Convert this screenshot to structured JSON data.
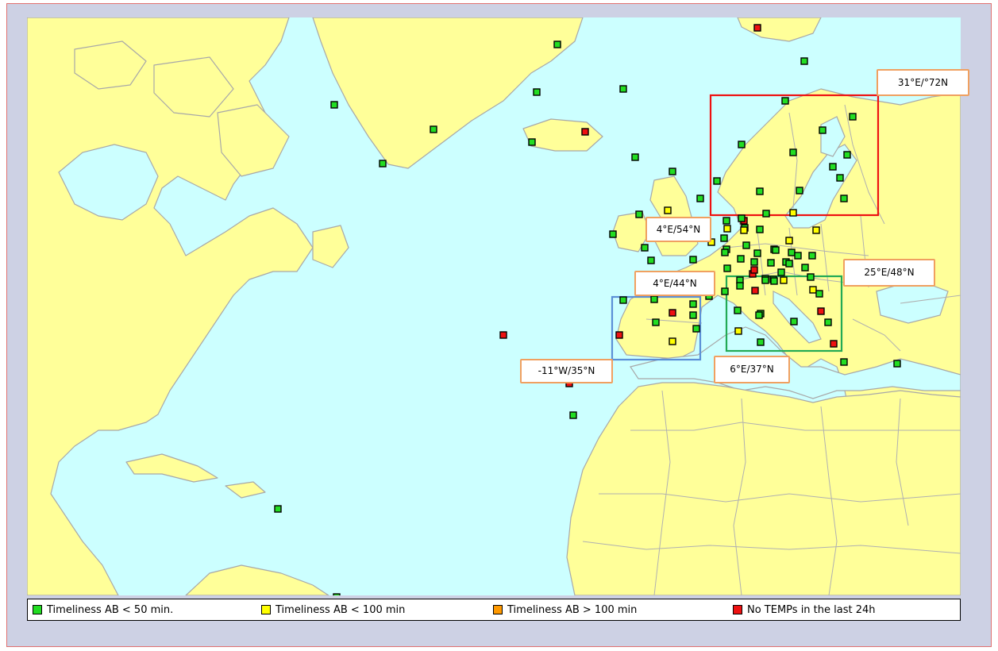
{
  "colors": {
    "ocean": "#ccffff",
    "land": "#ffff99",
    "coastline": "#a8a8a8",
    "frame": "#cdd1e4",
    "label_border": "#f0a060"
  },
  "status_colors": {
    "ok": "#22dd22",
    "late": "#ffff00",
    "very_late": "#ff9900",
    "missing": "#ee1111"
  },
  "regions": [
    {
      "id": "scandinavia",
      "color": "#ee1111",
      "corner_label": "31°E/°72N"
    },
    {
      "id": "central-europe",
      "color": "#f0a060",
      "corner_label": "4°E/54°N"
    },
    {
      "id": "central-east",
      "color": "#f0a060",
      "corner_label": "25°E/48°N"
    },
    {
      "id": "iberia",
      "color": "#5b8fd6",
      "corner_label": "4°E/44°N"
    },
    {
      "id": "iberia-sw",
      "color": "#5b8fd6",
      "corner_label": "-11°W/35°N"
    },
    {
      "id": "italy-balkans",
      "color": "#22aa55",
      "corner_label": "6°E/37°N"
    }
  ],
  "legend": [
    {
      "label": "Timeliness AB < 50 min.",
      "status": "ok"
    },
    {
      "label": "Timeliness AB < 100 min",
      "status": "late"
    },
    {
      "label": "Timeliness AB  > 100 min",
      "status": "very_late"
    },
    {
      "label": "No TEMPs in the last 24h",
      "status": "missing"
    }
  ],
  "stations_count": 122
}
